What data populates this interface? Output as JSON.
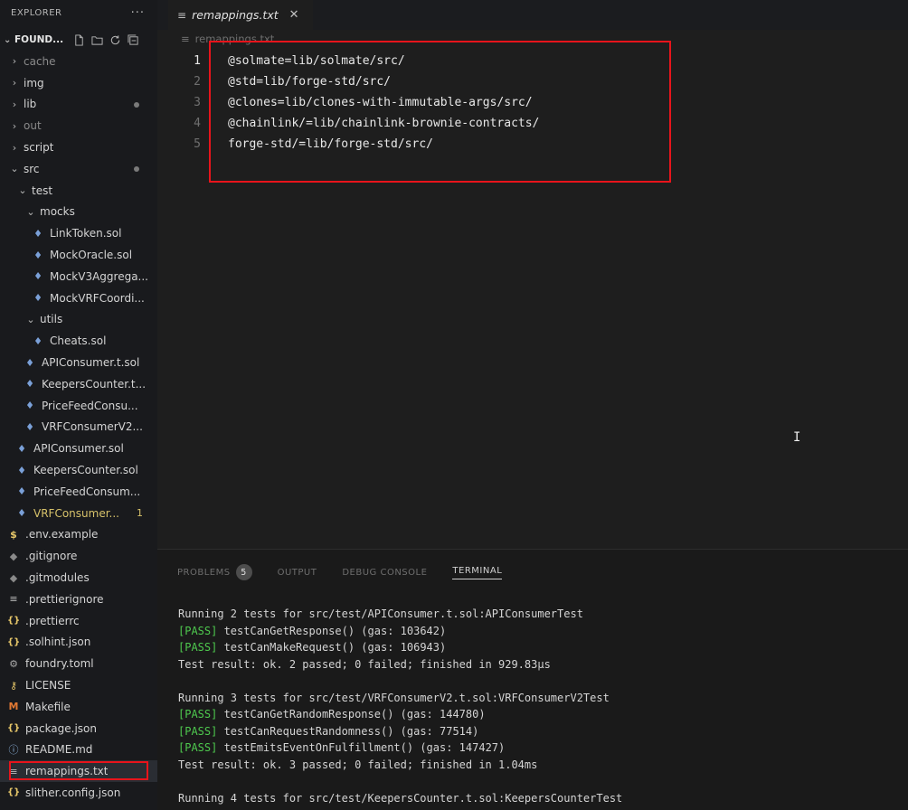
{
  "explorer": {
    "title": "EXPLORER",
    "more": "···",
    "folder": "FOUND...",
    "tree": [
      {
        "label": "cache",
        "type": "folder",
        "depth": 0,
        "open": false,
        "dim": true
      },
      {
        "label": "img",
        "type": "folder",
        "depth": 0,
        "open": false
      },
      {
        "label": "lib",
        "type": "folder",
        "depth": 0,
        "open": false,
        "dot": true
      },
      {
        "label": "out",
        "type": "folder",
        "depth": 0,
        "open": false,
        "dim": true
      },
      {
        "label": "script",
        "type": "folder",
        "depth": 0,
        "open": false
      },
      {
        "label": "src",
        "type": "folder",
        "depth": 0,
        "open": true,
        "dot": true
      },
      {
        "label": "test",
        "type": "folder",
        "depth": 1,
        "open": true
      },
      {
        "label": "mocks",
        "type": "folder",
        "depth": 2,
        "open": true
      },
      {
        "label": "LinkToken.sol",
        "type": "file",
        "icon": "solidity-icon",
        "depth": 3
      },
      {
        "label": "MockOracle.sol",
        "type": "file",
        "icon": "solidity-icon",
        "depth": 3
      },
      {
        "label": "MockV3Aggrega...",
        "type": "file",
        "icon": "solidity-icon",
        "depth": 3
      },
      {
        "label": "MockVRFCoordi...",
        "type": "file",
        "icon": "solidity-icon",
        "depth": 3
      },
      {
        "label": "utils",
        "type": "folder",
        "depth": 2,
        "open": true
      },
      {
        "label": "Cheats.sol",
        "type": "file",
        "icon": "solidity-icon",
        "depth": 3
      },
      {
        "label": "APIConsumer.t.sol",
        "type": "file",
        "icon": "solidity-icon",
        "depth": 2
      },
      {
        "label": "KeepersCounter.t...",
        "type": "file",
        "icon": "solidity-icon",
        "depth": 2
      },
      {
        "label": "PriceFeedConsu...",
        "type": "file",
        "icon": "solidity-icon",
        "depth": 2
      },
      {
        "label": "VRFConsumerV2...",
        "type": "file",
        "icon": "solidity-icon",
        "depth": 2
      },
      {
        "label": "APIConsumer.sol",
        "type": "file",
        "icon": "solidity-icon",
        "depth": 1
      },
      {
        "label": "KeepersCounter.sol",
        "type": "file",
        "icon": "solidity-icon",
        "depth": 1
      },
      {
        "label": "PriceFeedConsum...",
        "type": "file",
        "icon": "solidity-icon",
        "depth": 1
      },
      {
        "label": "VRFConsumer...",
        "type": "file",
        "icon": "solidity-icon",
        "depth": 1,
        "modified": true,
        "badge": "1"
      },
      {
        "label": ".env.example",
        "type": "file",
        "icon": "dollar-icon",
        "depth": 0
      },
      {
        "label": ".gitignore",
        "type": "file",
        "icon": "git-icon",
        "depth": 0
      },
      {
        "label": ".gitmodules",
        "type": "file",
        "icon": "git-icon",
        "depth": 0
      },
      {
        "label": ".prettierignore",
        "type": "file",
        "icon": "lines-icon",
        "depth": 0
      },
      {
        "label": ".prettierrc",
        "type": "file",
        "icon": "braces-icon",
        "depth": 0
      },
      {
        "label": ".solhint.json",
        "type": "file",
        "icon": "braces-icon",
        "depth": 0
      },
      {
        "label": "foundry.toml",
        "type": "file",
        "icon": "gear-icon",
        "depth": 0
      },
      {
        "label": "LICENSE",
        "type": "file",
        "icon": "key-icon",
        "depth": 0
      },
      {
        "label": "Makefile",
        "type": "file",
        "icon": "makefile-icon",
        "depth": 0
      },
      {
        "label": "package.json",
        "type": "file",
        "icon": "braces-icon",
        "depth": 0
      },
      {
        "label": "README.md",
        "type": "file",
        "icon": "info-icon",
        "depth": 0
      },
      {
        "label": "remappings.txt",
        "type": "file",
        "icon": "lines-icon",
        "depth": 0,
        "selected": true
      },
      {
        "label": "slither.config.json",
        "type": "file",
        "icon": "braces-icon",
        "depth": 0
      }
    ]
  },
  "editor": {
    "tab_label": "remappings.txt",
    "breadcrumb": "remappings.txt",
    "active_line": 1,
    "lines": [
      "@solmate=lib/solmate/src/",
      "@std=lib/forge-std/src/",
      "@clones=lib/clones-with-immutable-args/src/",
      "@chainlink/=lib/chainlink-brownie-contracts/",
      "forge-std/=lib/forge-std/src/"
    ]
  },
  "panel": {
    "tabs": [
      {
        "label": "PROBLEMS",
        "badge": "5"
      },
      {
        "label": "OUTPUT"
      },
      {
        "label": "DEBUG CONSOLE"
      },
      {
        "label": "TERMINAL",
        "active": true
      }
    ],
    "terminal_lines": [
      {
        "text": "Running 2 tests for src/test/APIConsumer.t.sol:APIConsumerTest"
      },
      {
        "pass": "[PASS]",
        "text": " testCanGetResponse() (gas: 103642)"
      },
      {
        "pass": "[PASS]",
        "text": " testCanMakeRequest() (gas: 106943)"
      },
      {
        "text": "Test result: ok. 2 passed; 0 failed; finished in 929.83µs"
      },
      {
        "text": ""
      },
      {
        "text": "Running 3 tests for src/test/VRFConsumerV2.t.sol:VRFConsumerV2Test"
      },
      {
        "pass": "[PASS]",
        "text": " testCanGetRandomResponse() (gas: 144780)"
      },
      {
        "pass": "[PASS]",
        "text": " testCanRequestRandomness() (gas: 77514)"
      },
      {
        "pass": "[PASS]",
        "text": " testEmitsEventOnFulfillment() (gas: 147427)"
      },
      {
        "text": "Test result: ok. 3 passed; 0 failed; finished in 1.04ms"
      },
      {
        "text": ""
      },
      {
        "text": "Running 4 tests for src/test/KeepersCounter.t.sol:KeepersCounterTest"
      }
    ]
  },
  "colors": {
    "highlight": "#e8141b",
    "pass": "#4ec94e",
    "modified": "#d7c26a"
  }
}
